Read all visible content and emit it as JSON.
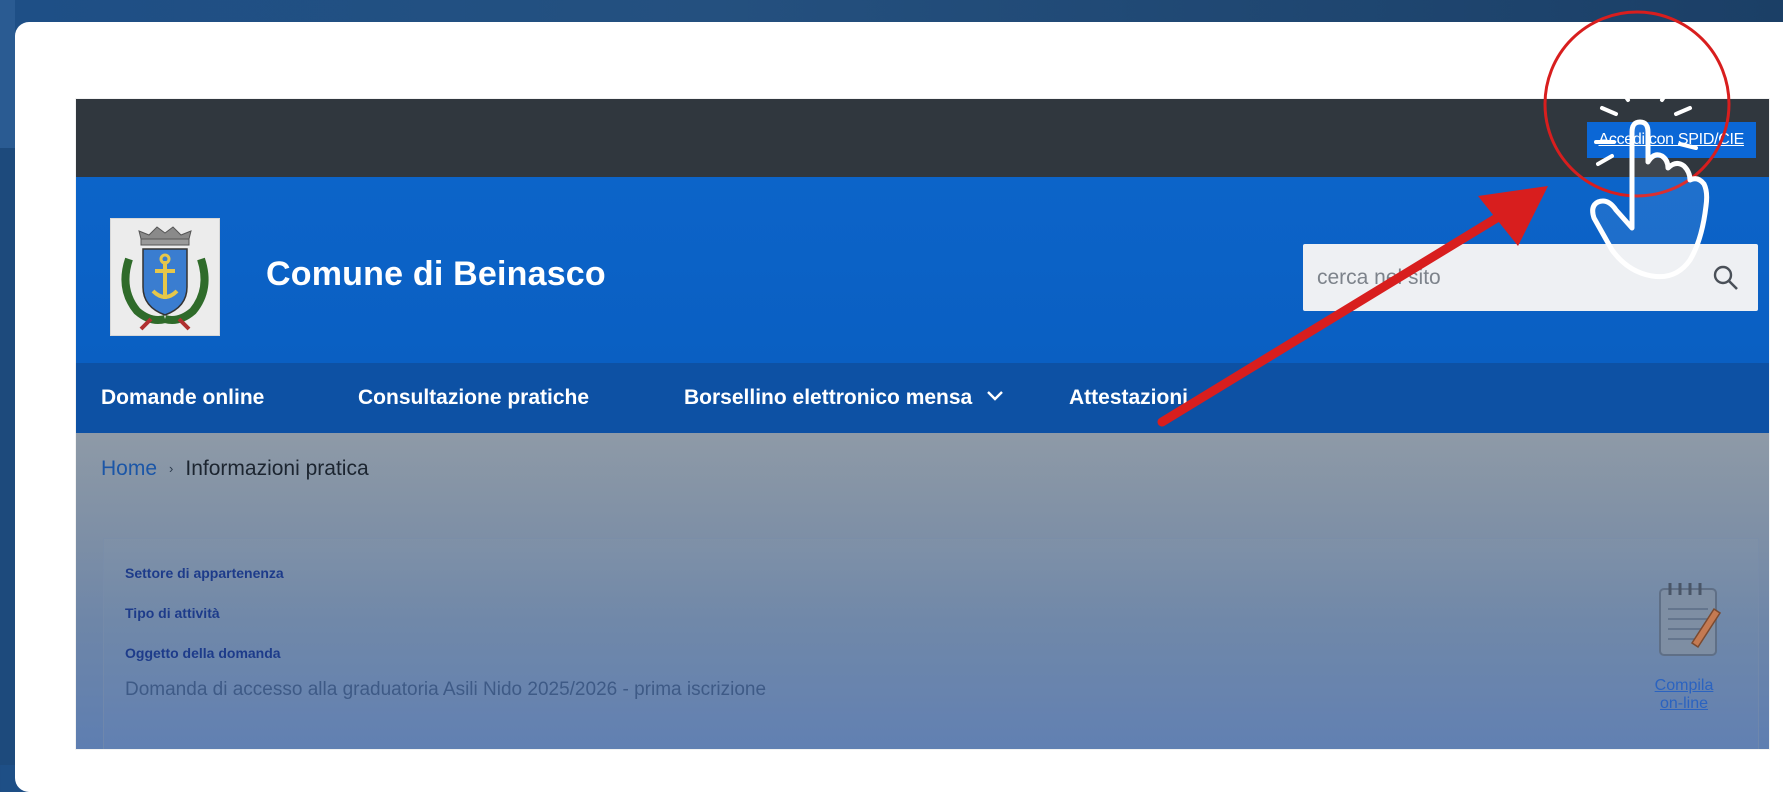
{
  "topbar": {
    "spid_link": "Accedi con SPID/CIE"
  },
  "header": {
    "title": "Comune di Beinasco",
    "search_placeholder": "cerca nel sito"
  },
  "nav": {
    "items": [
      {
        "label": "Domande online"
      },
      {
        "label": "Consultazione pratiche"
      },
      {
        "label": "Borsellino elettronico mensa"
      },
      {
        "label": "Attestazioni"
      }
    ]
  },
  "breadcrumb": {
    "home": "Home",
    "current": "Informazioni pratica"
  },
  "details": {
    "sector_label": "Settore di appartenenza",
    "activity_label": "Tipo di attività",
    "subject_label": "Oggetto della domanda",
    "subject_value": "Domanda di accesso alla graduatoria Asili Nido 2025/2026 - prima iscrizione",
    "compila_line1": "Compila",
    "compila_line2": "on-line"
  },
  "icons": [
    "coat-of-arms-logo",
    "search-icon",
    "chevron-down-icon",
    "notepad-pencil-icon",
    "pointing-hand-icon",
    "red-arrow"
  ],
  "colors": {
    "topbar": "#30373e",
    "header_blue": "#0c64c9",
    "nav_blue": "#0d51a4",
    "spid_button": "#0b67d6",
    "annotation_red": "#d81e1e"
  }
}
